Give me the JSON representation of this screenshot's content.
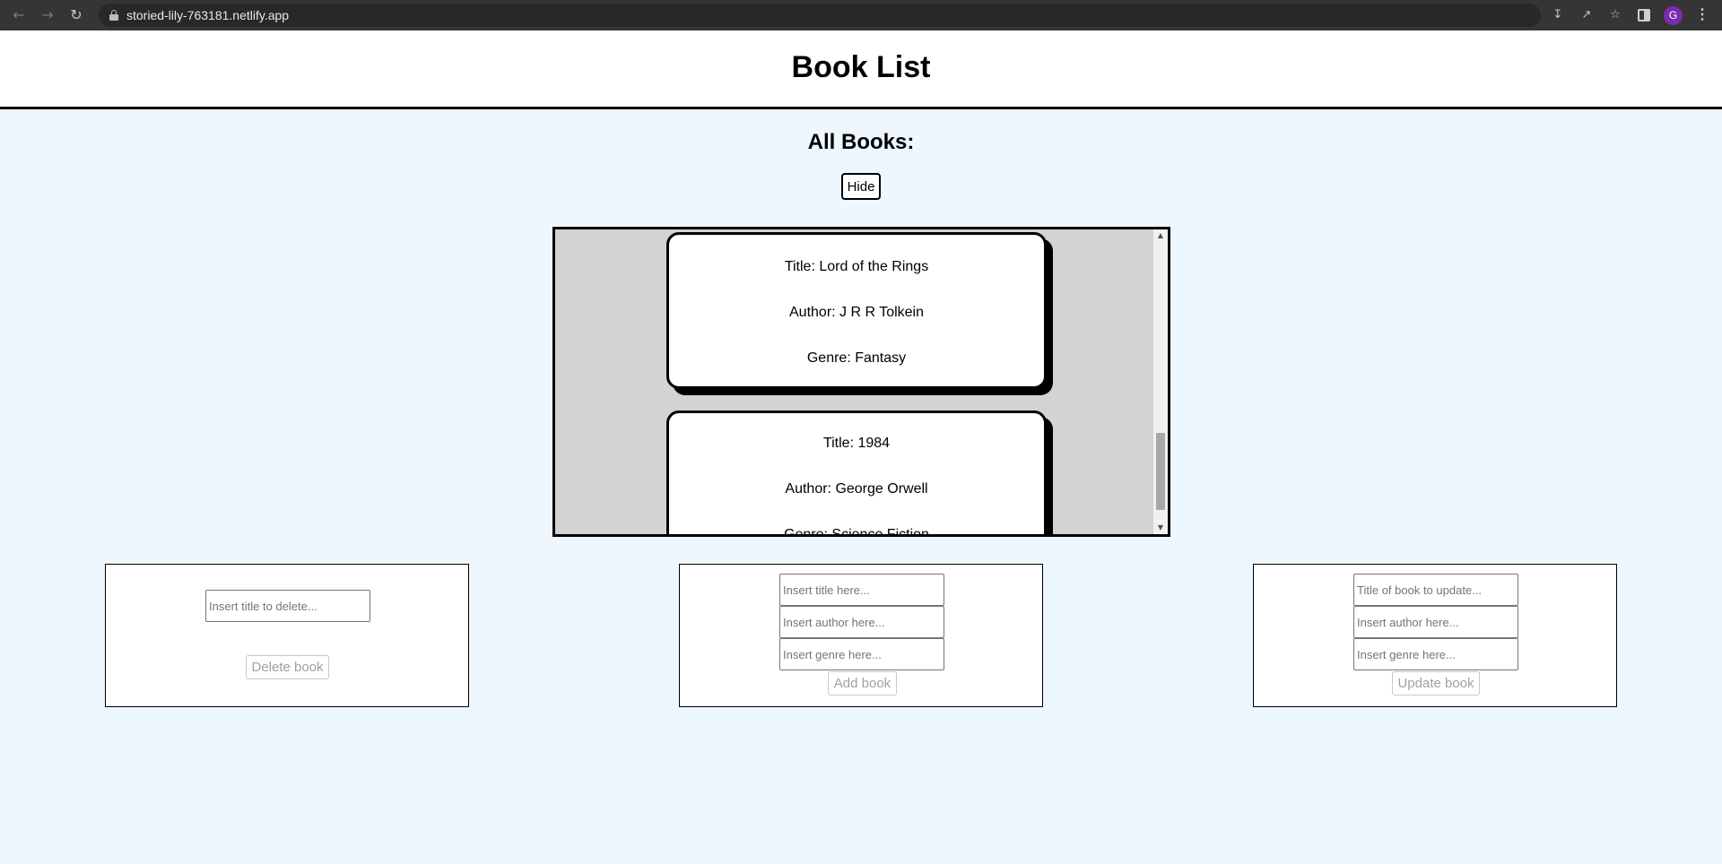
{
  "browser": {
    "url": "storied-lily-763181.netlify.app",
    "profile_initial": "G",
    "icons": [
      "back-arrow-icon",
      "forward-arrow-icon",
      "reload-icon",
      "lock-icon",
      "install-app-icon",
      "share-icon",
      "bookmark-star-icon",
      "side-panel-icon",
      "kebab-menu-icon"
    ]
  },
  "header": {
    "title": "Book List"
  },
  "books_section": {
    "heading": "All Books:",
    "toggle_label": "Hide",
    "books": [
      {
        "title": "Title: Lord of the Rings",
        "author": "Author: J R R Tolkein",
        "genre": "Genre: Fantasy"
      },
      {
        "title": "Title: 1984",
        "author": "Author: George Orwell",
        "genre": "Genre: Science Fiction"
      }
    ]
  },
  "delete_form": {
    "title_placeholder": "Insert title to delete...",
    "button_label": "Delete book"
  },
  "add_form": {
    "title_placeholder": "Insert title here...",
    "author_placeholder": "Insert author here...",
    "genre_placeholder": "Insert genre here...",
    "button_label": "Add book"
  },
  "update_form": {
    "title_placeholder": "Title of book to update...",
    "author_placeholder": "Insert author here...",
    "genre_placeholder": "Insert genre here...",
    "button_label": "Update book"
  },
  "colors": {
    "page_bg": "#eef6fe",
    "list_bg": "#d3d3d3",
    "chrome_bg": "#353535",
    "avatar": "#7c2bb0"
  }
}
